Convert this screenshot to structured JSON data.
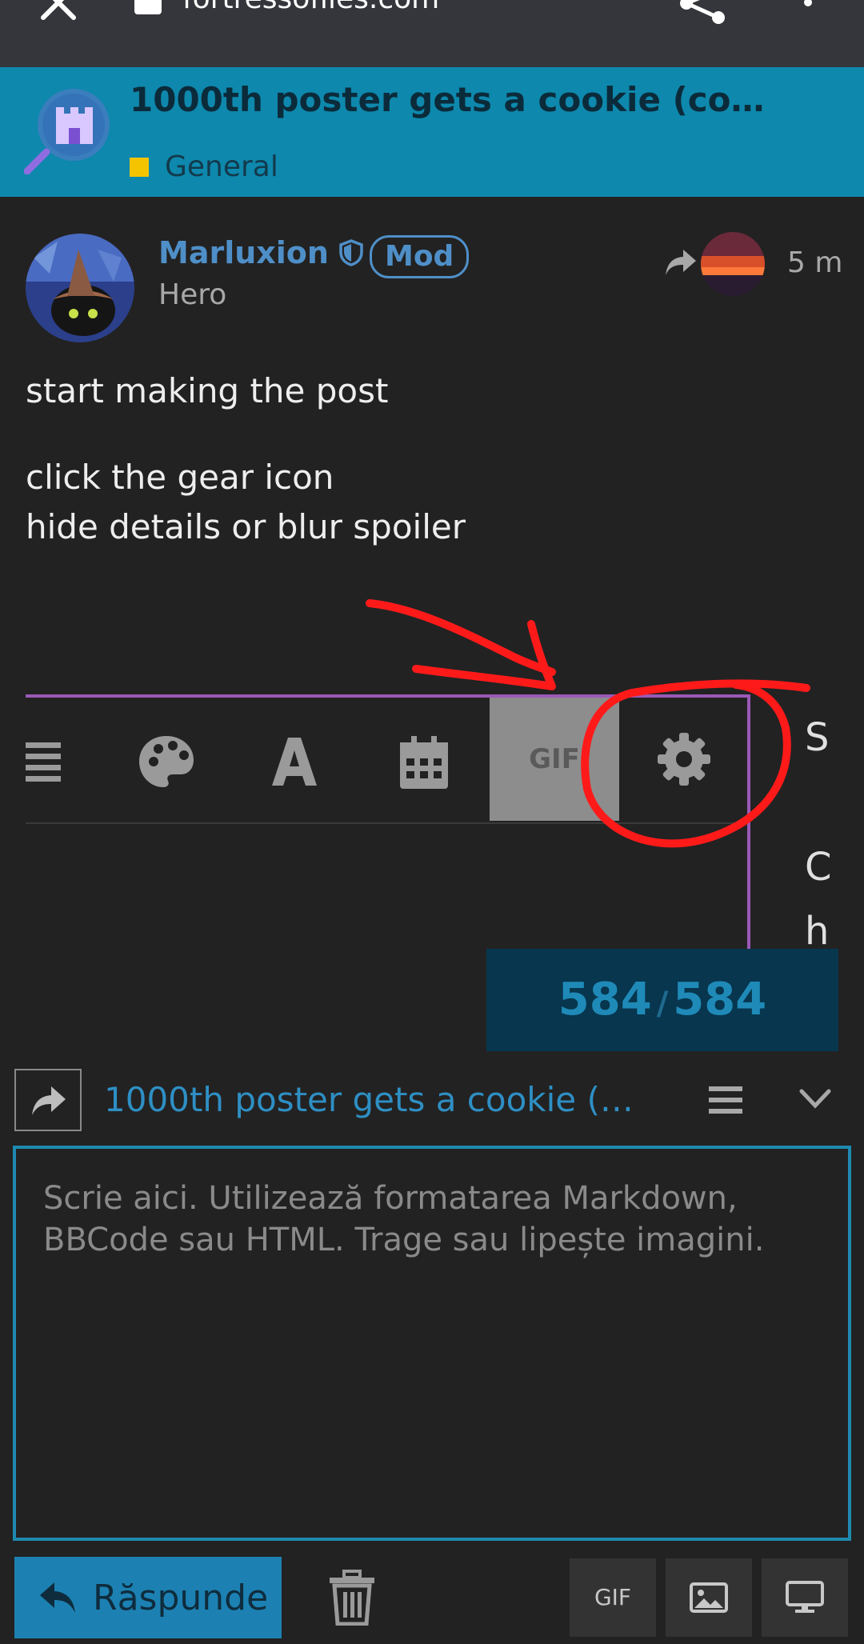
{
  "browser": {
    "url": "fortressofiles.com"
  },
  "topic": {
    "title": "1000th poster gets a cookie (cooki...",
    "category": "General",
    "category_color": "#f5c400",
    "header_color": "#0e88ad"
  },
  "post": {
    "username": "Marluxion",
    "badge": "Mod",
    "user_title": "Hero",
    "time": "5 m",
    "lines": [
      "start making the post",
      "click the gear icon",
      "hide details or blur spoiler"
    ]
  },
  "embedded_screenshot": {
    "toolbar_icons": [
      "list-icon",
      "palette-icon",
      "font-icon",
      "calendar-icon",
      "gif-button",
      "gear-icon"
    ],
    "gif_label": "GIF",
    "side_letters": [
      "S",
      "C",
      "h"
    ],
    "annotation_color": "#ff1a1a"
  },
  "progress": {
    "current": "584",
    "total": "584",
    "separator": "/"
  },
  "composer": {
    "title": "1000th poster gets a cookie (c...",
    "placeholder": "Scrie aici. Utilizează formatarea Markdown, BBCode sau HTML. Trage sau lipește imagini.",
    "reply_label": "Răspunde",
    "gif_label": "GIF"
  }
}
